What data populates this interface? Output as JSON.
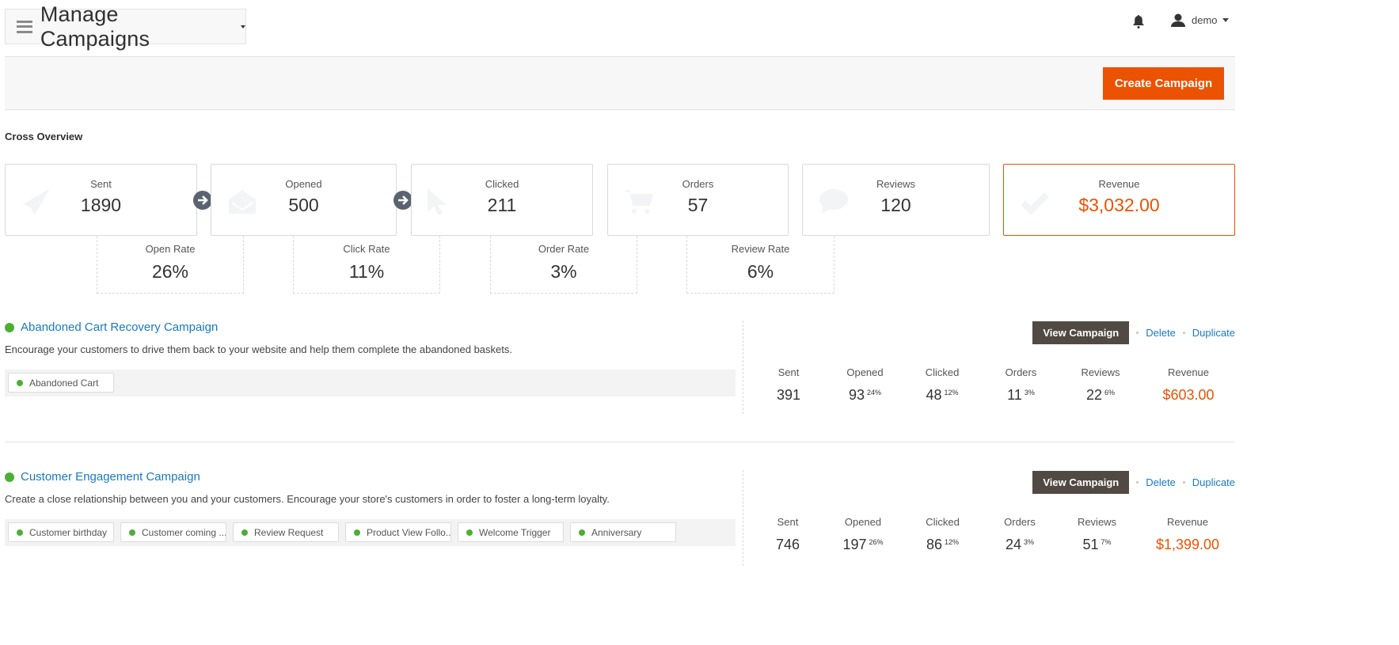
{
  "header": {
    "page_title": "Manage Campaigns",
    "menu_icon": "hamburger-icon",
    "notification_icon": "bell-icon",
    "user": {
      "name": "demo",
      "icon": "user-icon"
    }
  },
  "toolbar": {
    "create_label": "Create Campaign",
    "accent": "#eb5202"
  },
  "overview": {
    "title": "Cross Overview",
    "cards": [
      {
        "label": "Sent",
        "value": "1890",
        "icon": "paper-plane-icon"
      },
      {
        "label": "Opened",
        "value": "500",
        "icon": "envelope-open-icon"
      },
      {
        "label": "Clicked",
        "value": "211",
        "icon": "cursor-icon"
      },
      {
        "label": "Orders",
        "value": "57",
        "icon": "cart-icon"
      },
      {
        "label": "Reviews",
        "value": "120",
        "icon": "comment-icon"
      },
      {
        "label": "Revenue",
        "value": "$3,032.00",
        "icon": "check-icon"
      }
    ],
    "rates": [
      {
        "label": "Open Rate",
        "value": "26%"
      },
      {
        "label": "Click Rate",
        "value": "11%"
      },
      {
        "label": "Order Rate",
        "value": "3%"
      },
      {
        "label": "Review Rate",
        "value": "6%"
      }
    ]
  },
  "campaigns": [
    {
      "name": "Abandoned Cart Recovery Campaign",
      "status": "active",
      "description": "Encourage your customers to drive them back to your website and help them complete the abandoned baskets.",
      "triggers": [
        "Abandoned Cart"
      ],
      "actions": {
        "view": "View Campaign",
        "delete": "Delete",
        "duplicate": "Duplicate"
      },
      "stats": {
        "headers": [
          "Sent",
          "Opened",
          "Clicked",
          "Orders",
          "Reviews",
          "Revenue"
        ],
        "values": [
          {
            "v": "391",
            "pct": ""
          },
          {
            "v": "93",
            "pct": "24%"
          },
          {
            "v": "48",
            "pct": "12%"
          },
          {
            "v": "11",
            "pct": "3%"
          },
          {
            "v": "22",
            "pct": "6%"
          },
          {
            "v": "$603.00",
            "pct": ""
          }
        ]
      }
    },
    {
      "name": "Customer Engagement Campaign",
      "status": "active",
      "description": "Create a close relationship between you and your customers. Encourage your store's customers in order to foster a long-term loyalty.",
      "triggers": [
        "Customer birthday",
        "Customer coming ...",
        "Review Request",
        "Product View Follo...",
        "Welcome Trigger",
        "Anniversary"
      ],
      "actions": {
        "view": "View Campaign",
        "delete": "Delete",
        "duplicate": "Duplicate"
      },
      "stats": {
        "headers": [
          "Sent",
          "Opened",
          "Clicked",
          "Orders",
          "Reviews",
          "Revenue"
        ],
        "values": [
          {
            "v": "746",
            "pct": ""
          },
          {
            "v": "197",
            "pct": "26%"
          },
          {
            "v": "86",
            "pct": "12%"
          },
          {
            "v": "24",
            "pct": "3%"
          },
          {
            "v": "51",
            "pct": "7%"
          },
          {
            "v": "$1,399.00",
            "pct": ""
          }
        ]
      }
    }
  ]
}
